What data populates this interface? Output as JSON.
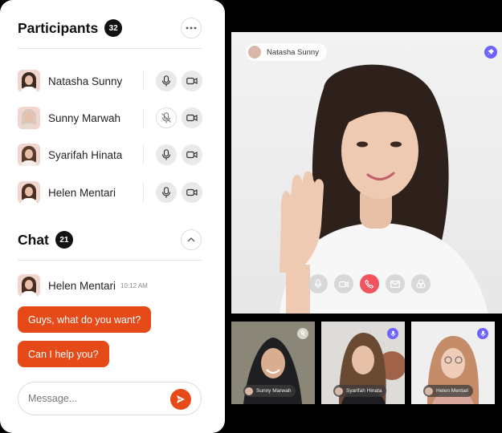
{
  "participants": {
    "title": "Participants",
    "count": "32",
    "list": [
      {
        "name": "Natasha Sunny",
        "mic": "on",
        "hair": "#3a2a22"
      },
      {
        "name": "Sunny Marwah",
        "mic": "muted",
        "hair": "#d8c7bd"
      },
      {
        "name": "Syarifah Hinata",
        "mic": "on",
        "hair": "#5a3a28"
      },
      {
        "name": "Helen Mentari",
        "mic": "on",
        "hair": "#4a2e20"
      }
    ]
  },
  "chat": {
    "title": "Chat",
    "count": "21",
    "sender": "Helen Mentari",
    "time": "10:12 AM",
    "messages": [
      "Guys, what do you want?",
      "Can I help you?"
    ],
    "input_placeholder": "Message..."
  },
  "main_video": {
    "name": "Natasha Sunny"
  },
  "thumbnails": [
    {
      "name": "Sunny Marwah",
      "mic": "muted"
    },
    {
      "name": "Syarifah Hinata",
      "mic": "on"
    },
    {
      "name": "Helen Mentari",
      "mic": "on"
    }
  ],
  "colors": {
    "accent": "#e64a19",
    "end_call": "#f1545e",
    "active_indicator": "#6c63ff"
  }
}
